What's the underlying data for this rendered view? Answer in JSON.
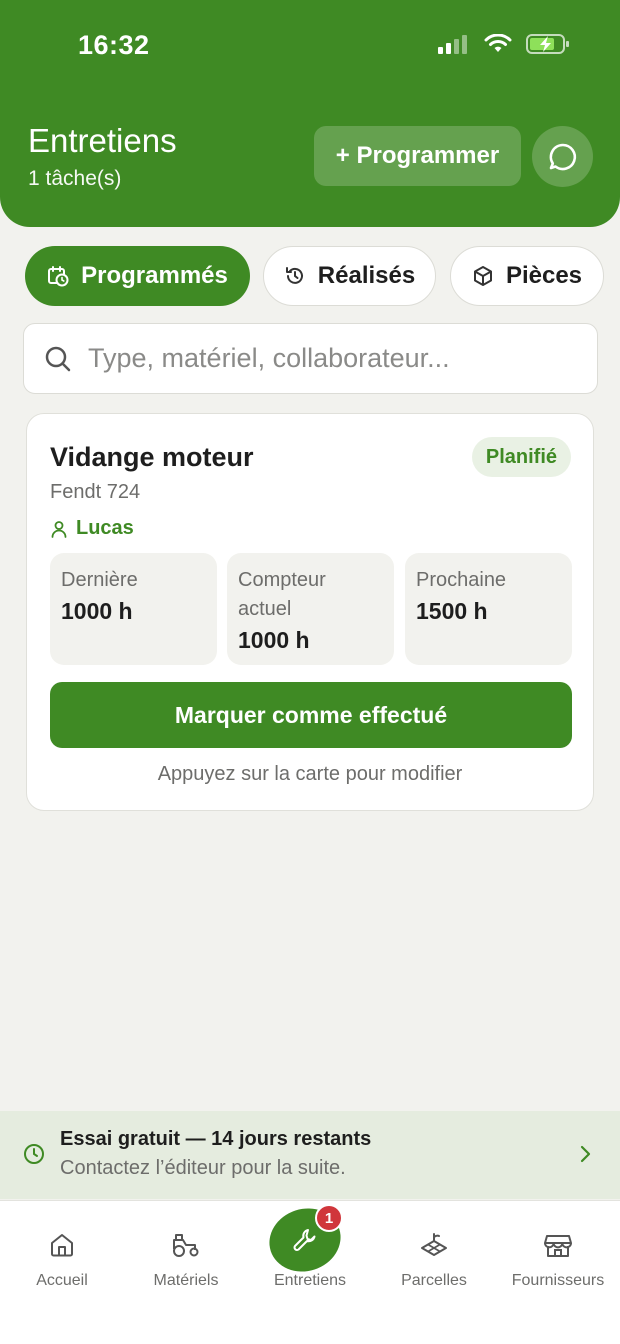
{
  "status_bar": {
    "time": "16:32"
  },
  "header": {
    "title": "Entretiens",
    "subtitle": "1 tâche(s)",
    "program_button": "+ Programmer"
  },
  "tabs": [
    {
      "label": "Programmés",
      "icon": "calendar-clock-icon",
      "active": true
    },
    {
      "label": "Réalisés",
      "icon": "history-icon",
      "active": false
    },
    {
      "label": "Pièces",
      "icon": "box-icon",
      "active": false
    }
  ],
  "search": {
    "placeholder": "Type, matériel, collaborateur...",
    "value": ""
  },
  "tasks": [
    {
      "title": "Vidange moteur",
      "status": "Planifié",
      "equipment": "Fendt 724",
      "assignee": "Lucas",
      "stats": [
        {
          "label": "Dernière",
          "value": "1000 h"
        },
        {
          "label": "Compteur actuel",
          "value": "1000 h"
        },
        {
          "label": "Prochaine",
          "value": "1500 h"
        }
      ],
      "action": "Marquer comme effectué",
      "hint": "Appuyez sur la carte pour modifier"
    }
  ],
  "trial_banner": {
    "title": "Essai gratuit — 14 jours restants",
    "subtitle": "Contactez l’éditeur pour la suite."
  },
  "bottom_nav": {
    "items": [
      {
        "label": "Accueil",
        "icon": "home-icon"
      },
      {
        "label": "Matériels",
        "icon": "tractor-icon"
      },
      {
        "label": "Entretiens",
        "icon": "wrench-icon",
        "active": true,
        "badge": "1"
      },
      {
        "label": "Parcelles",
        "icon": "field-icon"
      },
      {
        "label": "Fournisseurs",
        "icon": "store-icon"
      }
    ]
  },
  "colors": {
    "primary": "#3f8a24",
    "background": "#f2f2ee",
    "badge_red": "#d0363b"
  }
}
